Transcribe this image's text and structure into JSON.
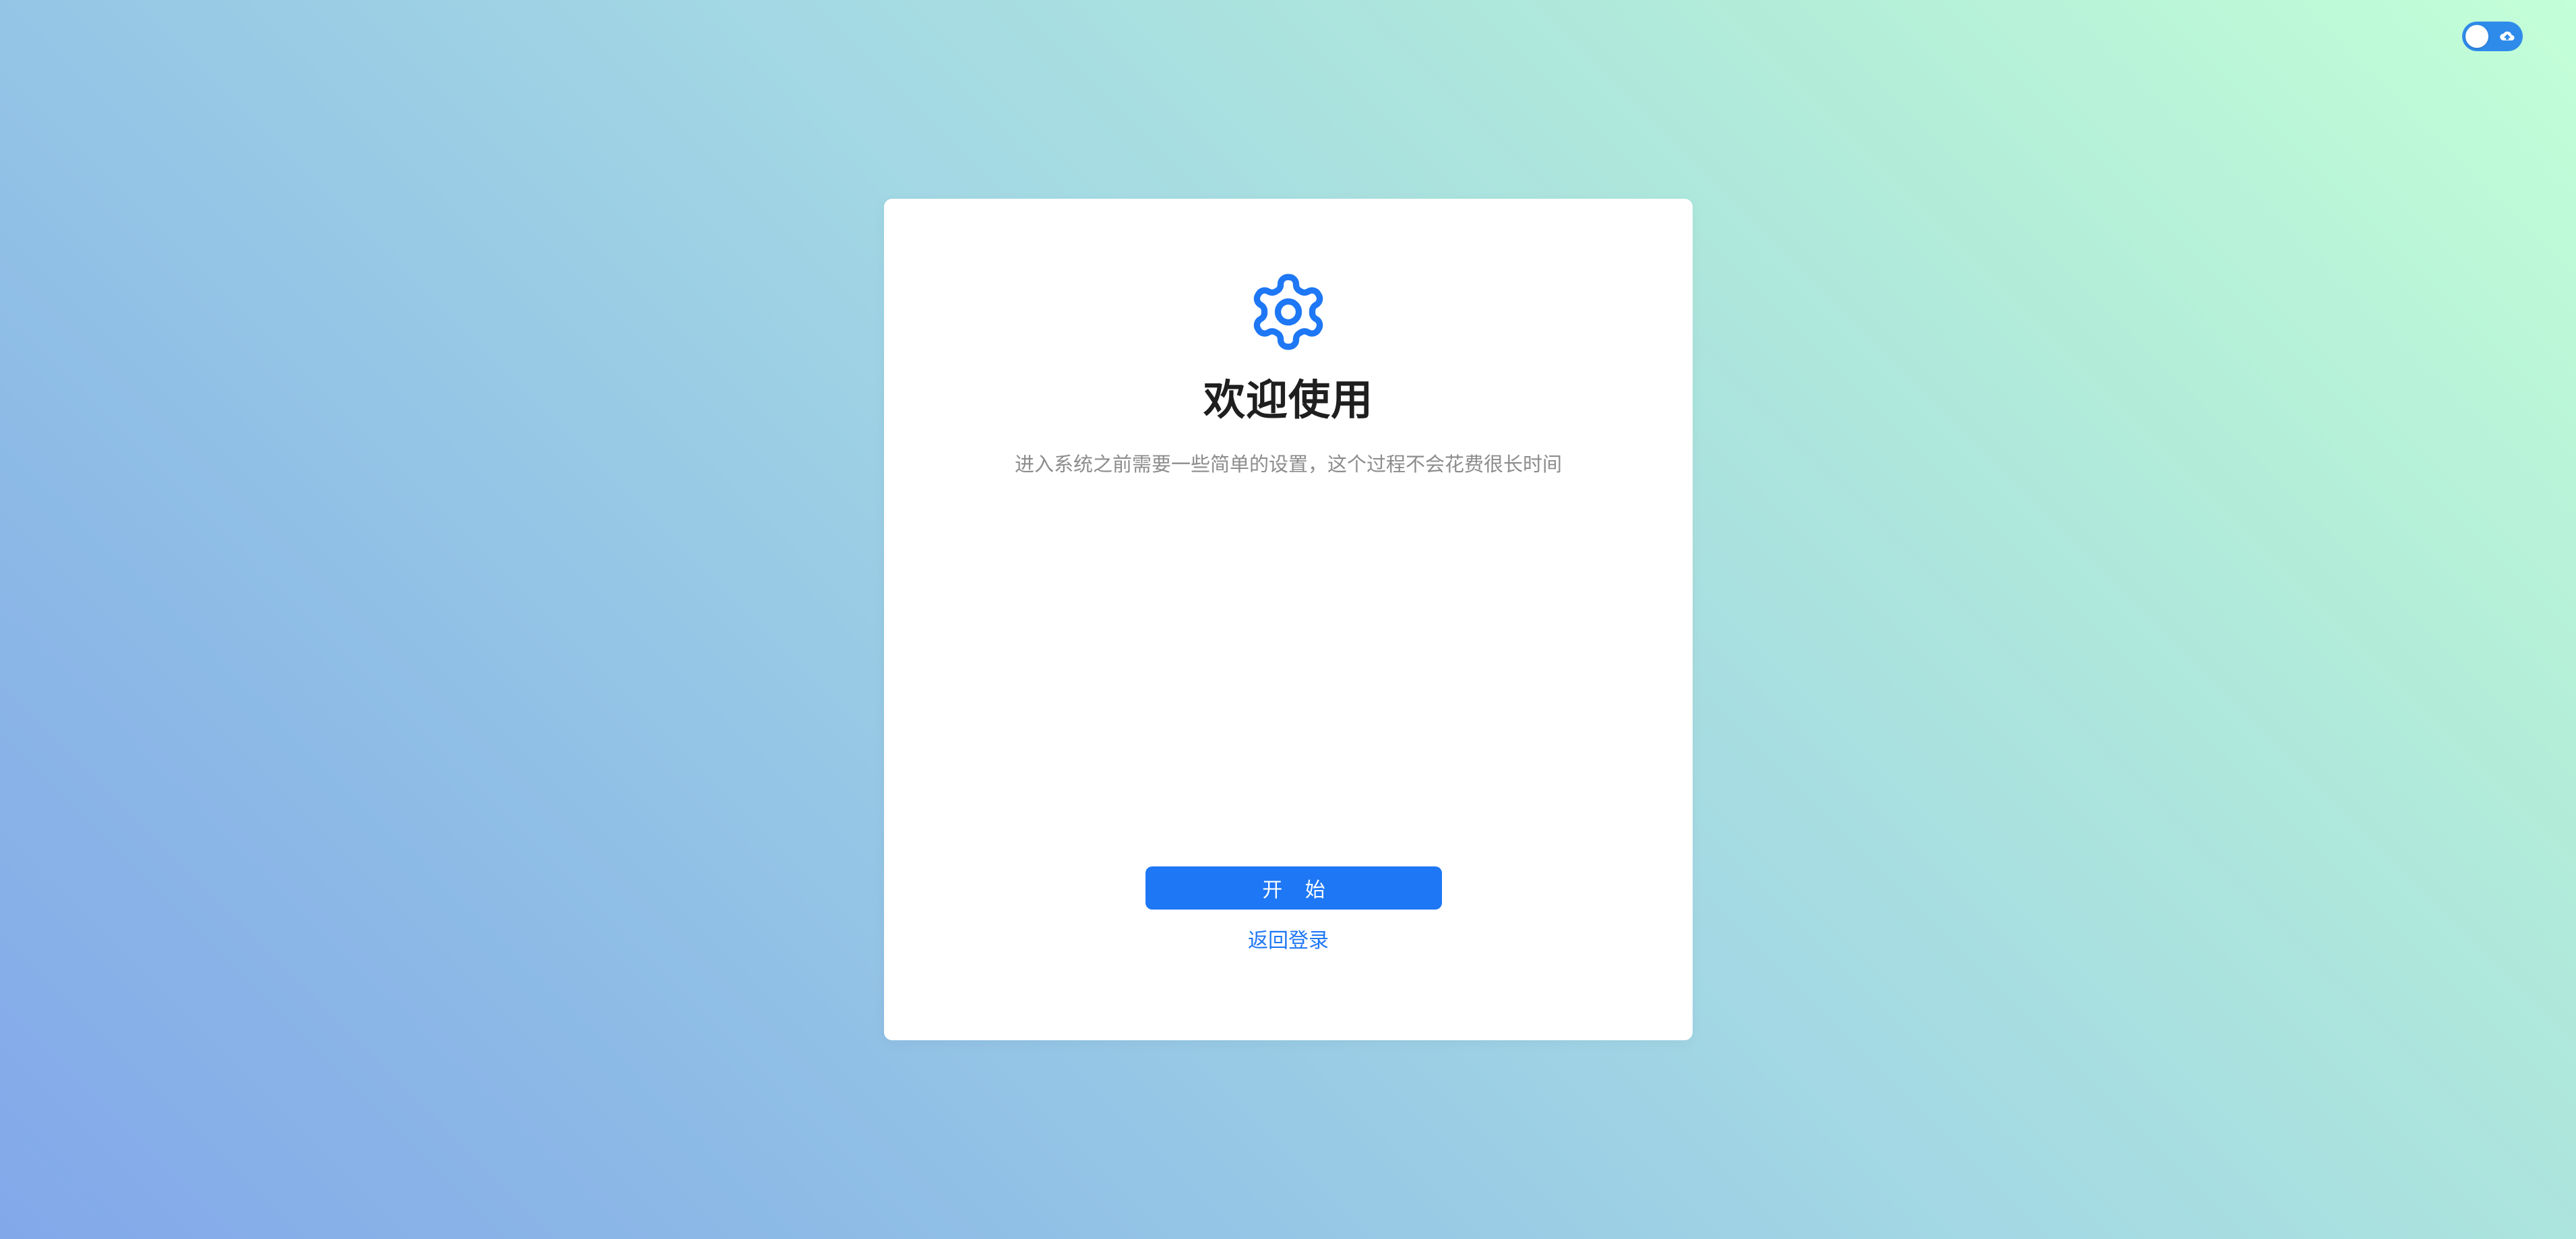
{
  "theme_toggle": {
    "icon": "cloud-icon",
    "colors": {
      "track": "#2f8bea",
      "knob": "#ffffff"
    }
  },
  "card": {
    "icon": "gear-icon",
    "title": "欢迎使用",
    "subtitle": "进入系统之前需要一些简单的设置，这个过程不会花费很长时间",
    "start_label": "开 始",
    "back_label": "返回登录"
  },
  "colors": {
    "accent": "#1e77f5",
    "title_text": "#1f1f1f",
    "subtitle_text": "#8c8c8c",
    "card_background": "#ffffff",
    "background_gradient": [
      "#c3ffd8",
      "#a3d8e4",
      "#83a8ea"
    ]
  }
}
